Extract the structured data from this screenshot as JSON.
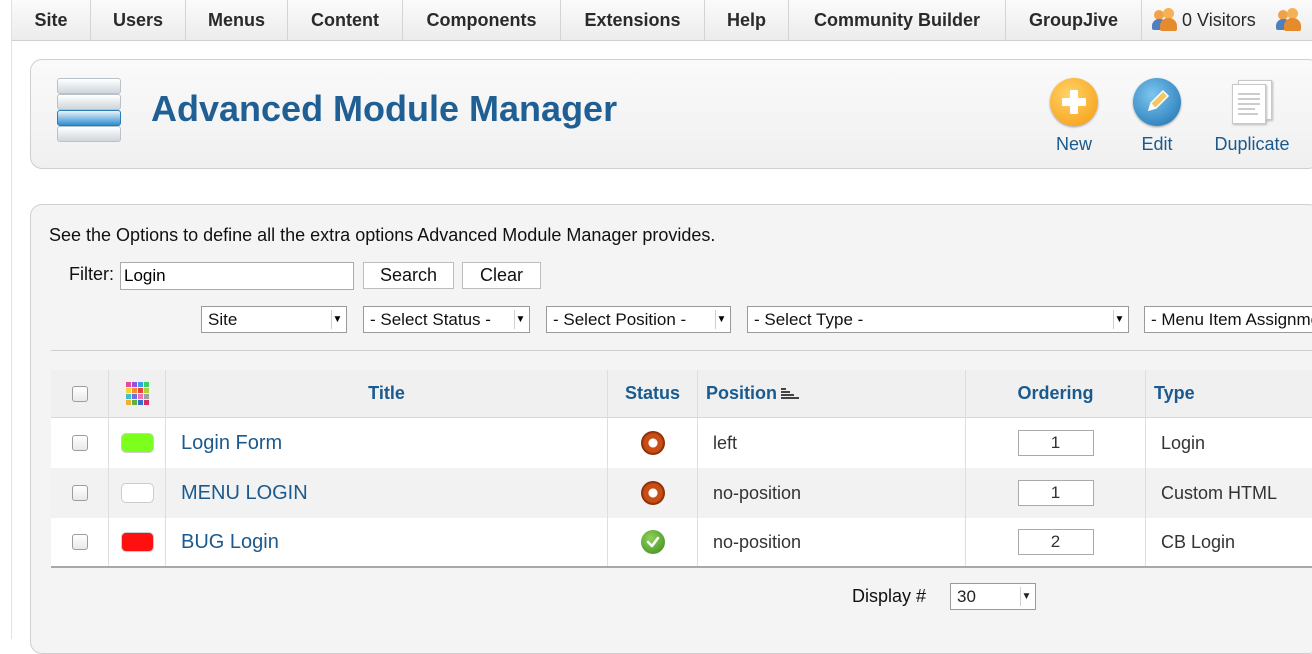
{
  "menubar": {
    "items": [
      "Site",
      "Users",
      "Menus",
      "Content",
      "Components",
      "Extensions",
      "Help",
      "Community Builder",
      "GroupJive"
    ],
    "visitors": "0 Visitors"
  },
  "header": {
    "title": "Advanced Module Manager",
    "toolbar": {
      "new_label": "New",
      "edit_label": "Edit",
      "duplicate_label": "Duplicate"
    }
  },
  "content": {
    "info": "See the Options to define all the extra options Advanced Module Manager provides.",
    "filter": {
      "label": "Filter:",
      "value": "Login",
      "search_label": "Search",
      "clear_label": "Clear"
    },
    "selects": {
      "client": "Site",
      "status": "- Select Status -",
      "position": "- Select Position -",
      "type": "- Select Type -",
      "menu_assignment": "- Menu Item Assignment -"
    },
    "table": {
      "headers": {
        "title": "Title",
        "status": "Status",
        "position": "Position",
        "ordering": "Ordering",
        "type": "Type"
      },
      "rows": [
        {
          "title": "Login Form",
          "status": "unpublished",
          "position": "left",
          "ordering": "1",
          "type": "Login",
          "color": "#7dff1e"
        },
        {
          "title": "MENU LOGIN",
          "status": "unpublished",
          "position": "no-position",
          "ordering": "1",
          "type": "Custom HTML",
          "color": "#ffffff"
        },
        {
          "title": "BUG Login",
          "status": "published",
          "position": "no-position",
          "ordering": "2",
          "type": "CB Login",
          "color": "#ff1010"
        }
      ]
    },
    "display": {
      "label": "Display #",
      "value": "30"
    }
  },
  "colors": {
    "accent": "#1a5a8e",
    "title": "#1f5f93"
  }
}
